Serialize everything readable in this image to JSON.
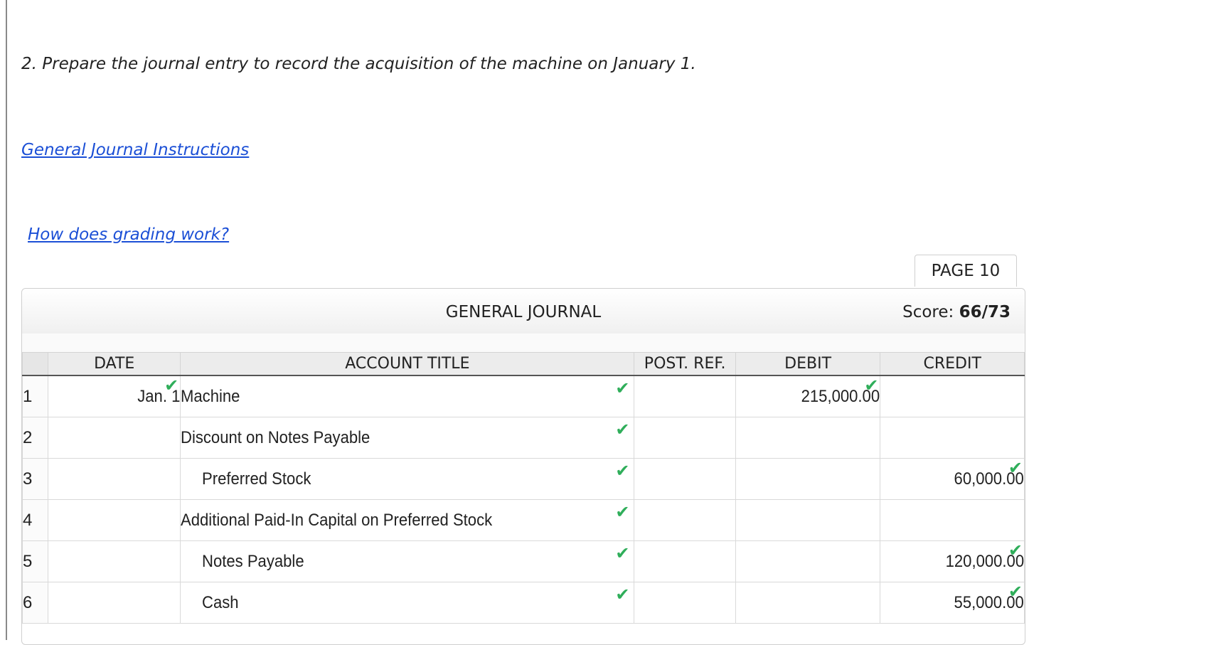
{
  "question": "2. Prepare the journal entry to record the acquisition of the machine on January 1.",
  "links": {
    "instructions": "General Journal Instructions",
    "grading": "How does grading work?"
  },
  "journal": {
    "page_tab": "PAGE 10",
    "title": "GENERAL JOURNAL",
    "score_label": "Score:",
    "score_value": "66/73",
    "columns": {
      "date": "DATE",
      "account": "ACCOUNT TITLE",
      "post_ref": "POST. REF.",
      "debit": "DEBIT",
      "credit": "CREDIT"
    },
    "rows": [
      {
        "num": "1",
        "date": "Jan. 1",
        "account": "Machine",
        "indent": false,
        "post_ref": "",
        "debit": "215,000.00",
        "credit": ""
      },
      {
        "num": "2",
        "date": "",
        "account": "Discount on Notes Payable",
        "indent": false,
        "post_ref": "",
        "debit": "",
        "credit": ""
      },
      {
        "num": "3",
        "date": "",
        "account": "Preferred Stock",
        "indent": true,
        "post_ref": "",
        "debit": "",
        "credit": "60,000.00"
      },
      {
        "num": "4",
        "date": "",
        "account": "Additional Paid-In Capital on Preferred Stock",
        "indent": false,
        "post_ref": "",
        "debit": "",
        "credit": ""
      },
      {
        "num": "5",
        "date": "",
        "account": "Notes Payable",
        "indent": true,
        "post_ref": "",
        "debit": "",
        "credit": "120,000.00"
      },
      {
        "num": "6",
        "date": "",
        "account": "Cash",
        "indent": true,
        "post_ref": "",
        "debit": "",
        "credit": "55,000.00"
      }
    ]
  },
  "colors": {
    "check": "#2fae5a",
    "link": "#1b4fd6"
  },
  "icons": {
    "check": "check-icon"
  }
}
